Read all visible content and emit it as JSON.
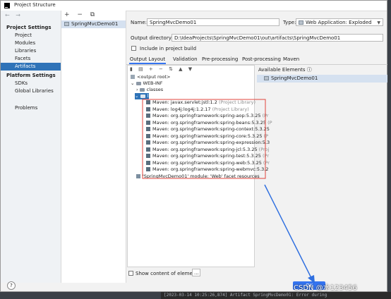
{
  "window": {
    "title": "Project Structure"
  },
  "left": {
    "project_settings": "Project Settings",
    "items": [
      "Project",
      "Modules",
      "Libraries",
      "Facets",
      "Artifacts"
    ],
    "platform_settings": "Platform Settings",
    "platform_items": [
      "SDKs",
      "Global Libraries"
    ],
    "problems": "Problems"
  },
  "artifacts": {
    "toolbar": "+ − ⧉",
    "selected": "SpringMvcDemo01"
  },
  "form": {
    "name_label": "Name:",
    "name_value": "SpringMvcDemo01",
    "type_label": "Type:",
    "type_value": "Web Application: Exploded",
    "output_label": "Output directory:",
    "output_value": "D:\\IdeaProjects\\SpringMvcDemo01\\out\\artifacts\\SpringMvcDemo01",
    "include_build": "Include in project build"
  },
  "tabs": [
    "Output Layout",
    "Validation",
    "Pre-processing",
    "Post-processing",
    "Maven"
  ],
  "tree": {
    "toolbar": "▮ ▤ + − ⇅ ▲ ▼",
    "output_root": "<output root>",
    "web_inf": "WEB-INF",
    "classes": "classes",
    "lib": "lib",
    "libs": [
      {
        "name": "Maven: javax.servlet:jstl:1.2",
        "suffix": " (Project Library)"
      },
      {
        "name": "Maven: log4j:log4j:1.2.17",
        "suffix": " (Project Library)"
      },
      {
        "name": "Maven: org.springframework:spring-aop:5.3.25",
        "suffix": " (Pr"
      },
      {
        "name": "Maven: org.springframework:spring-beans:5.3.25",
        "suffix": " (P"
      },
      {
        "name": "Maven: org.springframework:spring-context:5.3.25",
        "suffix": ""
      },
      {
        "name": "Maven: org.springframework:spring-core:5.3.25",
        "suffix": " (P"
      },
      {
        "name": "Maven: org.springframework:spring-expression:5.3",
        "suffix": ""
      },
      {
        "name": "Maven: org.springframework:spring-jcl:5.3.25",
        "suffix": " (Proj"
      },
      {
        "name": "Maven: org.springframework:spring-test:5.3.25",
        "suffix": " (Pr"
      },
      {
        "name": "Maven: org.springframework:spring-web:5.3.25",
        "suffix": " (Pr"
      },
      {
        "name": "Maven: org.springframework:spring-webmvc:5.3.2",
        "suffix": ""
      }
    ],
    "facet_res": "'SpringMvcDemo01' module: 'Web' facet resources"
  },
  "available": {
    "header": "Available Elements ⓘ",
    "item": "SpringMvcDemo01"
  },
  "bottom": {
    "show_content": "Show content of elements",
    "more": "...",
    "help": "?",
    "ok": "OK"
  },
  "background": {
    "console": "[2023-03-14 10:25:26,874] Artifact SpringMvcDemo01: Error during",
    "watermark": "CSDN @水123456"
  }
}
